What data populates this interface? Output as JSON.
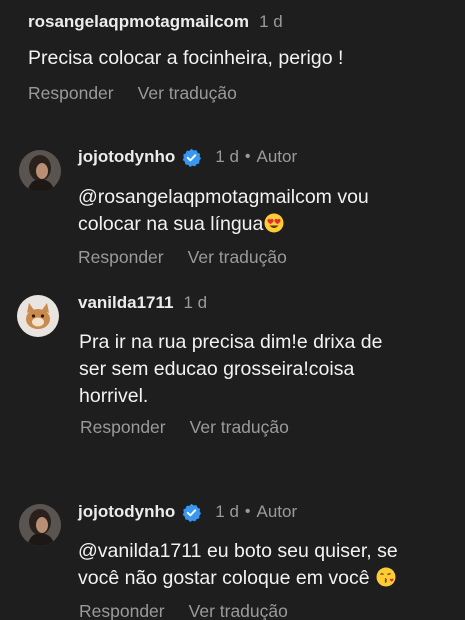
{
  "comments": [
    {
      "username": "rosangelaqpmotagmailcom",
      "time": "1 d",
      "lines": [
        "Precisa colocar a focinheira, perigo !"
      ],
      "reply_label": "Responder",
      "translate_label": "Ver tradução"
    },
    {
      "username": "jojotodynho",
      "verified": true,
      "time": "1 d",
      "separator": "•",
      "author_label": "Autor",
      "lines": [
        "@rosangelaqpmotagmailcom vou",
        "colocar na sua língua"
      ],
      "emoji": "heart-eyes-emoji",
      "reply_label": "Responder",
      "translate_label": "Ver tradução"
    },
    {
      "username": "vanilda1711",
      "time": "1 d",
      "lines": [
        "Pra ir na rua precisa dim!e drixa de",
        "ser sem educao grosseira!coisa",
        "horrivel."
      ],
      "reply_label": "Responder",
      "translate_label": "Ver tradução"
    },
    {
      "username": "jojotodynho",
      "verified": true,
      "time": "1 d",
      "separator": "•",
      "author_label": "Autor",
      "lines": [
        "@vanilda1711 eu boto seu quiser, se",
        "você não gostar coloque em você"
      ],
      "emoji": "kissing-heart-emoji",
      "reply_label": "Responder",
      "translate_label": "Ver tradução"
    }
  ],
  "colors": {
    "background": "#1e1e1e",
    "text": "#f2f2f2",
    "muted": "#9a9a9a",
    "verified": "#3897f0"
  }
}
